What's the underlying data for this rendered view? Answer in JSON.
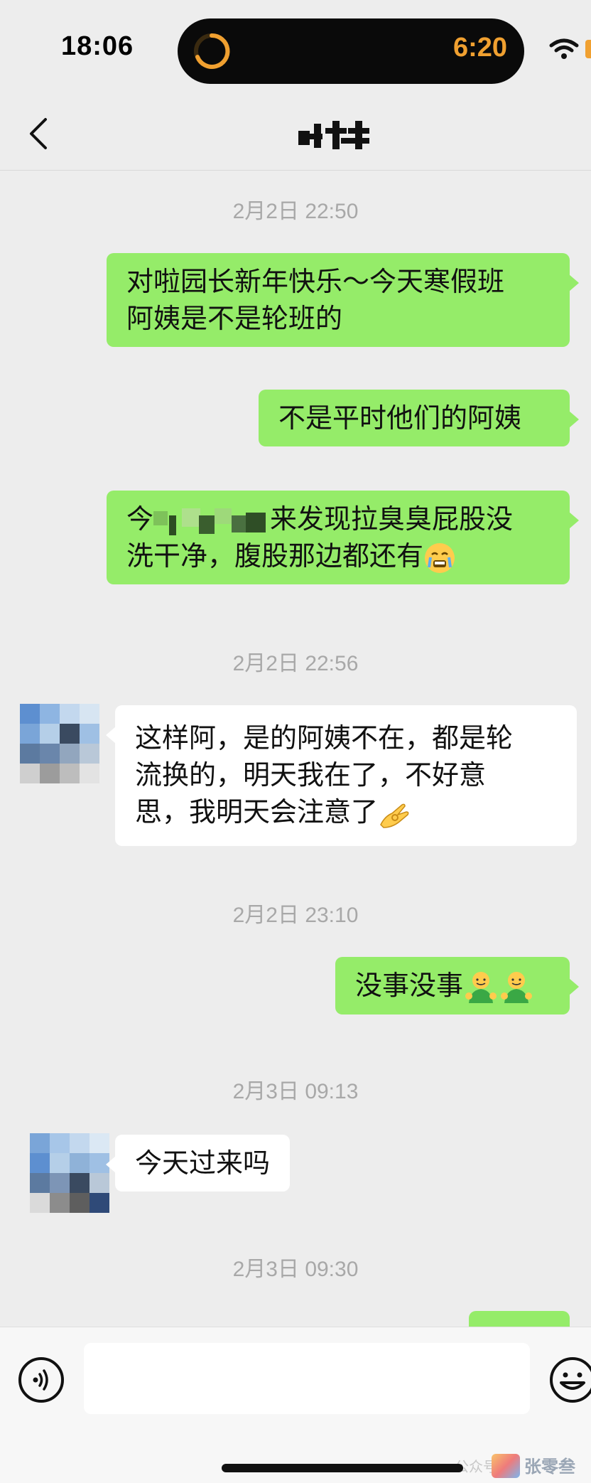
{
  "status_bar": {
    "time": "18:06",
    "island_timer": "6:20"
  },
  "header": {
    "back_icon": "chevron-left-icon"
  },
  "messages": [
    {
      "type": "timestamp",
      "text": "2月2日 22:50"
    },
    {
      "type": "out",
      "lines": [
        "对啦园长新年快乐～今天寒假班",
        "阿姨是不是轮班的"
      ]
    },
    {
      "type": "out",
      "lines": [
        "不是平时他们的阿姨"
      ]
    },
    {
      "type": "out",
      "lines": [
        "今",
        "来发现拉臭臭屁股没",
        "洗干净，腹股那边都还有"
      ],
      "emoji": "crying-face-emoji"
    },
    {
      "type": "timestamp",
      "text": "2月2日 22:56"
    },
    {
      "type": "in",
      "lines": [
        "这样阿，是的阿姨不在，都是轮",
        "流换的，明天我在了，不好意",
        "思，我明天会注意了"
      ],
      "emoji": "ok-hand-emoji"
    },
    {
      "type": "timestamp",
      "text": "2月2日 23:10"
    },
    {
      "type": "out",
      "lines": [
        "没事没事"
      ],
      "emoji": "green-smiley-emoji"
    },
    {
      "type": "timestamp",
      "text": "2月3日 09:13"
    },
    {
      "type": "in",
      "lines": [
        "今天过来吗"
      ]
    },
    {
      "type": "timestamp",
      "text": "2月3日 09:30"
    }
  ],
  "input_bar": {
    "voice_icon": "voice-icon",
    "emoji_icon": "emoji-icon",
    "text_value": ""
  },
  "watermark": {
    "prefix": "公众号",
    "brand": "张零叁"
  },
  "colors": {
    "outgoing_bubble": "#95ec69",
    "incoming_bubble": "#ffffff",
    "background": "#ededed",
    "timestamp": "#a8a8a8",
    "island_timer": "#f0a030"
  }
}
